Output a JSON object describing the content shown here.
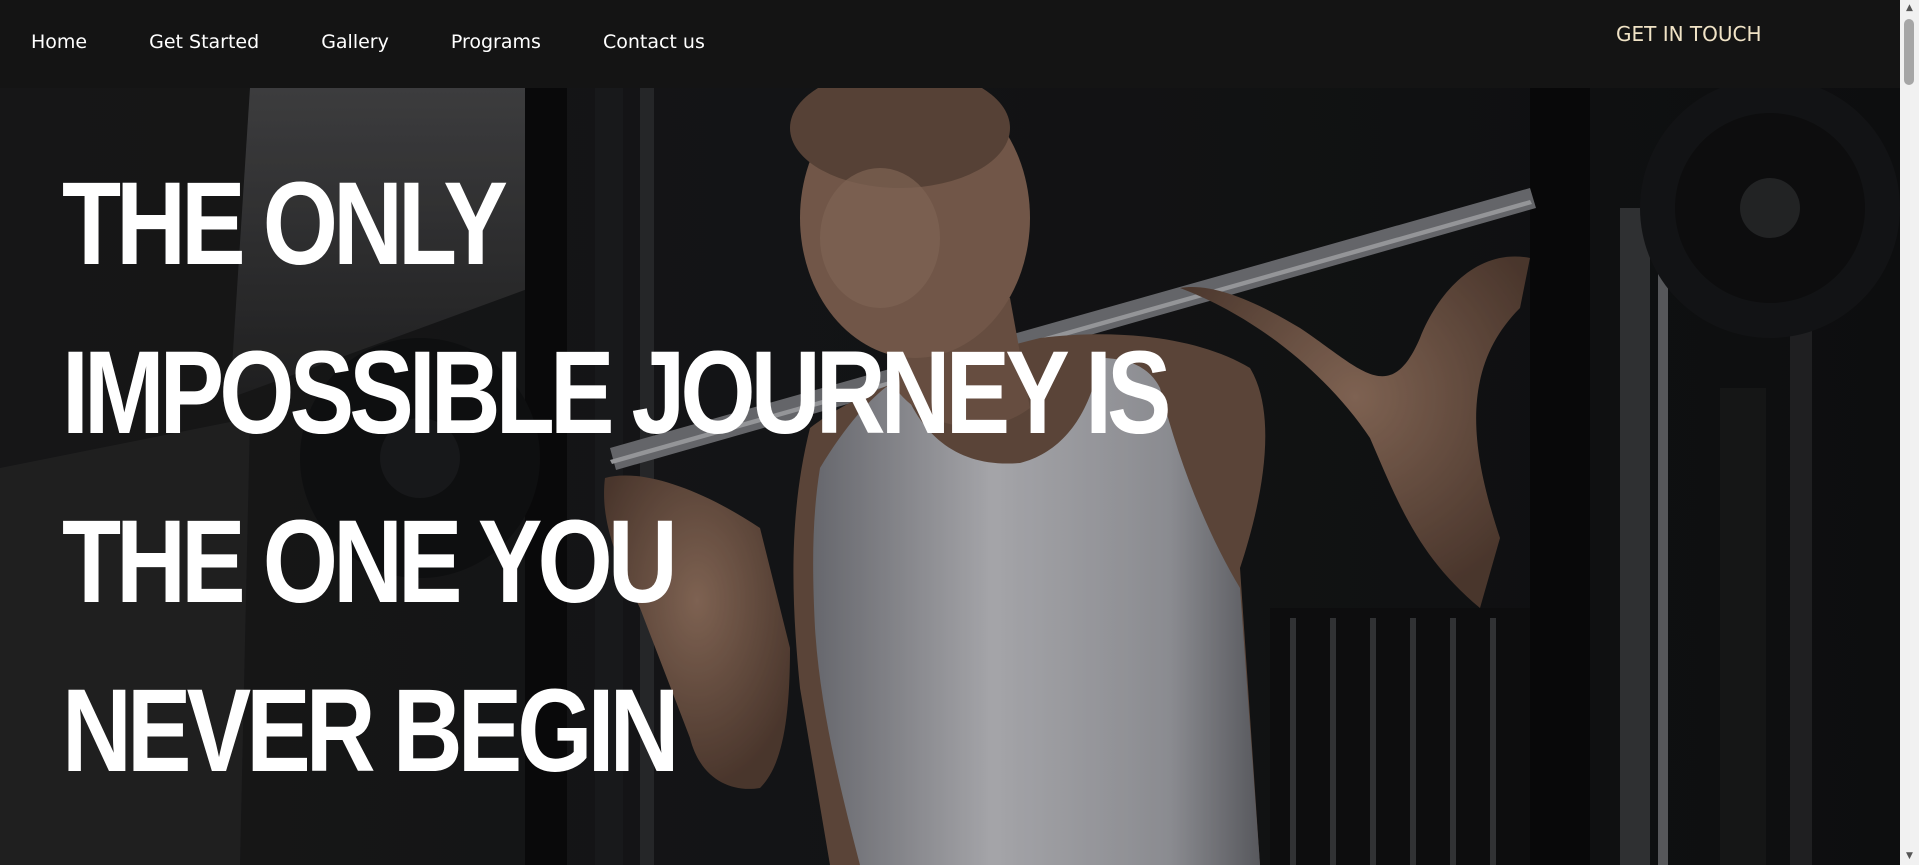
{
  "nav": {
    "items": [
      {
        "label": "Home"
      },
      {
        "label": "Get Started"
      },
      {
        "label": "Gallery"
      },
      {
        "label": "Programs"
      },
      {
        "label": "Contact us"
      }
    ],
    "cta_label": "GET IN TOUCH"
  },
  "hero": {
    "lines": [
      "THE ONLY",
      "IMPOSSIBLE JOURNEY IS",
      "THE ONE YOU",
      "NEVER BEGIN"
    ],
    "image_subject": "man in white tank top doing barbell squat in gym"
  },
  "scrollbar": {
    "up_icon": "triangle-up-icon",
    "down_icon": "triangle-down-icon"
  },
  "colors": {
    "nav_background": "#141414",
    "nav_text": "#ffffff",
    "cta_text": "#f0e3c6",
    "headline_text": "#ffffff"
  }
}
